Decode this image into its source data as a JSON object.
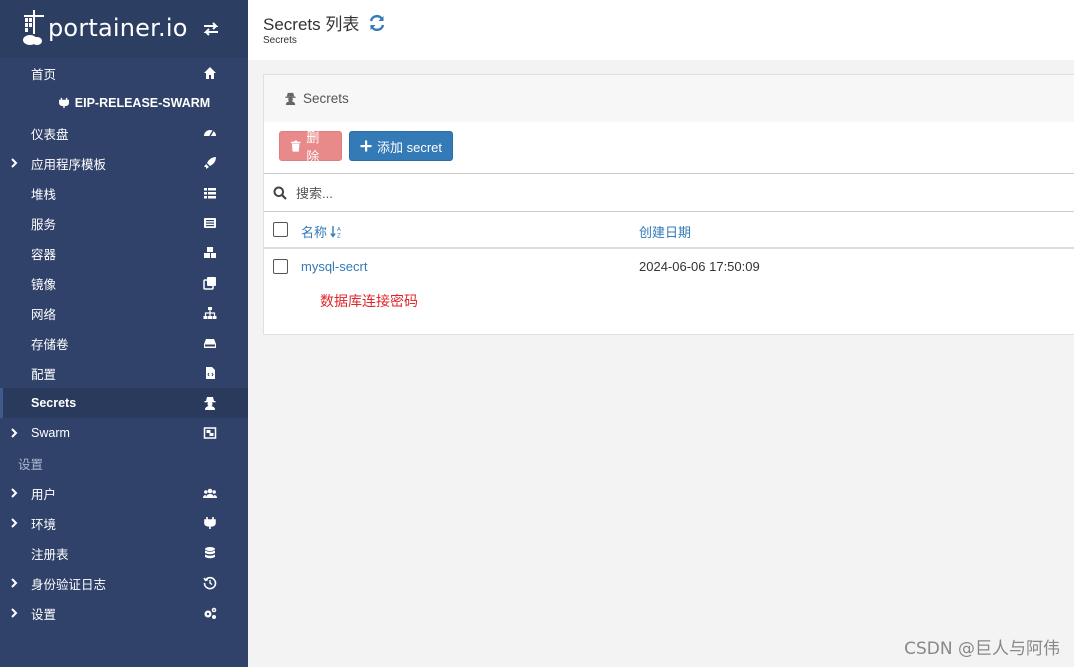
{
  "app": {
    "logo_text": "portainer.io",
    "icons": {
      "logo": "portainer-logo-icon",
      "toggle": "exchange-arrows-icon"
    }
  },
  "sidebar": {
    "items": [
      {
        "label": "首页",
        "icon": "home-icon",
        "has_chevron": false
      },
      {
        "label": "EIP-RELEASE-SWARM",
        "icon": "plug-icon",
        "env": true
      },
      {
        "label": "仪表盘",
        "icon": "dashboard-icon",
        "has_chevron": false
      },
      {
        "label": "应用程序模板",
        "icon": "rocket-icon",
        "has_chevron": true
      },
      {
        "label": "堆栈",
        "icon": "list-icon",
        "has_chevron": false
      },
      {
        "label": "服务",
        "icon": "list-alt-icon",
        "has_chevron": false
      },
      {
        "label": "容器",
        "icon": "cubes-icon",
        "has_chevron": false
      },
      {
        "label": "镜像",
        "icon": "clone-icon",
        "has_chevron": false
      },
      {
        "label": "网络",
        "icon": "sitemap-icon",
        "has_chevron": false
      },
      {
        "label": "存储卷",
        "icon": "hdd-icon",
        "has_chevron": false
      },
      {
        "label": "配置",
        "icon": "file-code-icon",
        "has_chevron": false
      },
      {
        "label": "Secrets",
        "icon": "user-secret-icon",
        "has_chevron": false,
        "active": true
      },
      {
        "label": "Swarm",
        "icon": "object-group-icon",
        "has_chevron": true
      }
    ],
    "section_label": "设置",
    "settings_items": [
      {
        "label": "用户",
        "icon": "users-icon",
        "has_chevron": true
      },
      {
        "label": "环境",
        "icon": "plug-icon",
        "has_chevron": true
      },
      {
        "label": "注册表",
        "icon": "database-icon",
        "has_chevron": false
      },
      {
        "label": "身份验证日志",
        "icon": "history-icon",
        "has_chevron": true
      },
      {
        "label": "设置",
        "icon": "cogs-icon",
        "has_chevron": true
      }
    ]
  },
  "header": {
    "title": "Secrets 列表",
    "breadcrumb": "Secrets",
    "refresh_icon": "refresh-icon"
  },
  "widget": {
    "title": "Secrets",
    "title_icon": "user-secret-icon",
    "delete_label": "删除",
    "add_label": "添加 secret",
    "search_placeholder": "搜索...",
    "columns": {
      "name": "名称",
      "date": "创建日期"
    },
    "rows": [
      {
        "name": "mysql-secrt",
        "date": "2024-06-06 17:50:09"
      }
    ],
    "annotation": "数据库连接密码"
  },
  "watermark": "CSDN @巨人与阿伟",
  "colors": {
    "sidebar_bg": "#30426a",
    "primary": "#337ab7",
    "danger_disabled": "#e8898a",
    "annotation": "#e0262b"
  }
}
